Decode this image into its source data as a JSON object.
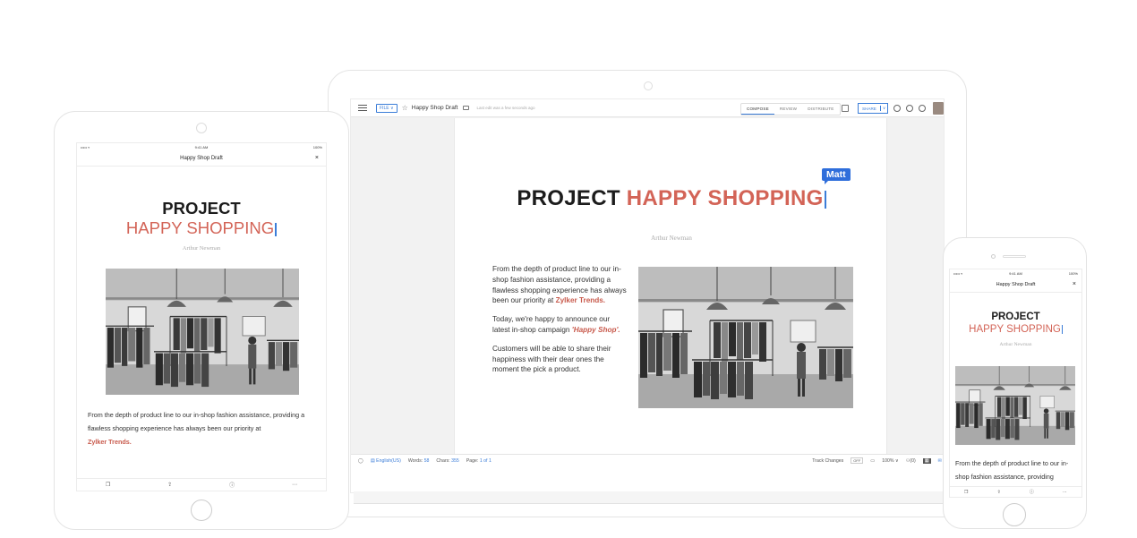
{
  "document": {
    "title": "Happy Shop Draft",
    "last_edit": "Last edit was a few seconds ago",
    "headline_black": "PROJECT",
    "headline_red": "HAPPY SHOPPING",
    "author": "Arthur Newman",
    "collaborator_tag": "Matt"
  },
  "toolbar": {
    "file_label": "FILE ∨",
    "tabs": [
      "COMPOSE",
      "REVIEW",
      "DISTRIBUTE"
    ],
    "share_label": "SHARE",
    "share_caret": "∨"
  },
  "body": {
    "p1": "From the depth of product line to our in-shop fashion assistance, providing a flawless shopping experience has always been our priority at",
    "p1_brand": "Zylker Trends.",
    "p2": "Today, we're happy to announce our latest in-shop campaign",
    "p2_campaign": "'Happy Shop'.",
    "p3": "Customers will be able to share their happiness with their dear ones the moment the pick a product."
  },
  "statusbar": {
    "language": "English(US)",
    "words_label": "Words:",
    "words_value": "58",
    "chars_label": "Chars:",
    "chars_value": "355",
    "page_label": "Page:",
    "page_value": "1",
    "page_of": "of 1",
    "track_changes": "Track Changes",
    "track_toggle": "OFF",
    "zoom": "100%",
    "zoom_caret": "∨",
    "users_count": "(0)"
  },
  "tablet": {
    "status_time": "9:41 AM",
    "status_battery": "100%",
    "status_signal": "••••• ▿",
    "nav_title": "Happy Shop Draft",
    "nav_close": "×",
    "title_line1": "PROJECT",
    "title_line2": "HAPPY SHOPPING",
    "author": "Arthur Newman",
    "body": "From the depth of product line to our in-shop fashion assistance, providing a flawless shopping experience has always been our priority at",
    "brand": "Zylker Trends.",
    "bar_icons": [
      "❒",
      "⇪",
      "ⓘ",
      "⋯"
    ]
  },
  "phone": {
    "status_time": "9:41 AM",
    "status_battery": "100%",
    "status_signal": "••••• ▿",
    "nav_title": "Happy Shop Draft",
    "nav_close": "×",
    "title_line1": "PROJECT",
    "title_line2": "HAPPY SHOPPING",
    "author": "Arthur Newman",
    "body": "From the depth of product line to our in-shop fashion assistance, providing",
    "bar_icons": [
      "❒",
      "⇪",
      "ⓘ",
      "⋯"
    ]
  },
  "colors": {
    "accent_blue": "#3b7dd8",
    "headline_red": "#d36457",
    "brand_red": "#c85a4c",
    "collaborator_tag": "#2f6edb"
  }
}
